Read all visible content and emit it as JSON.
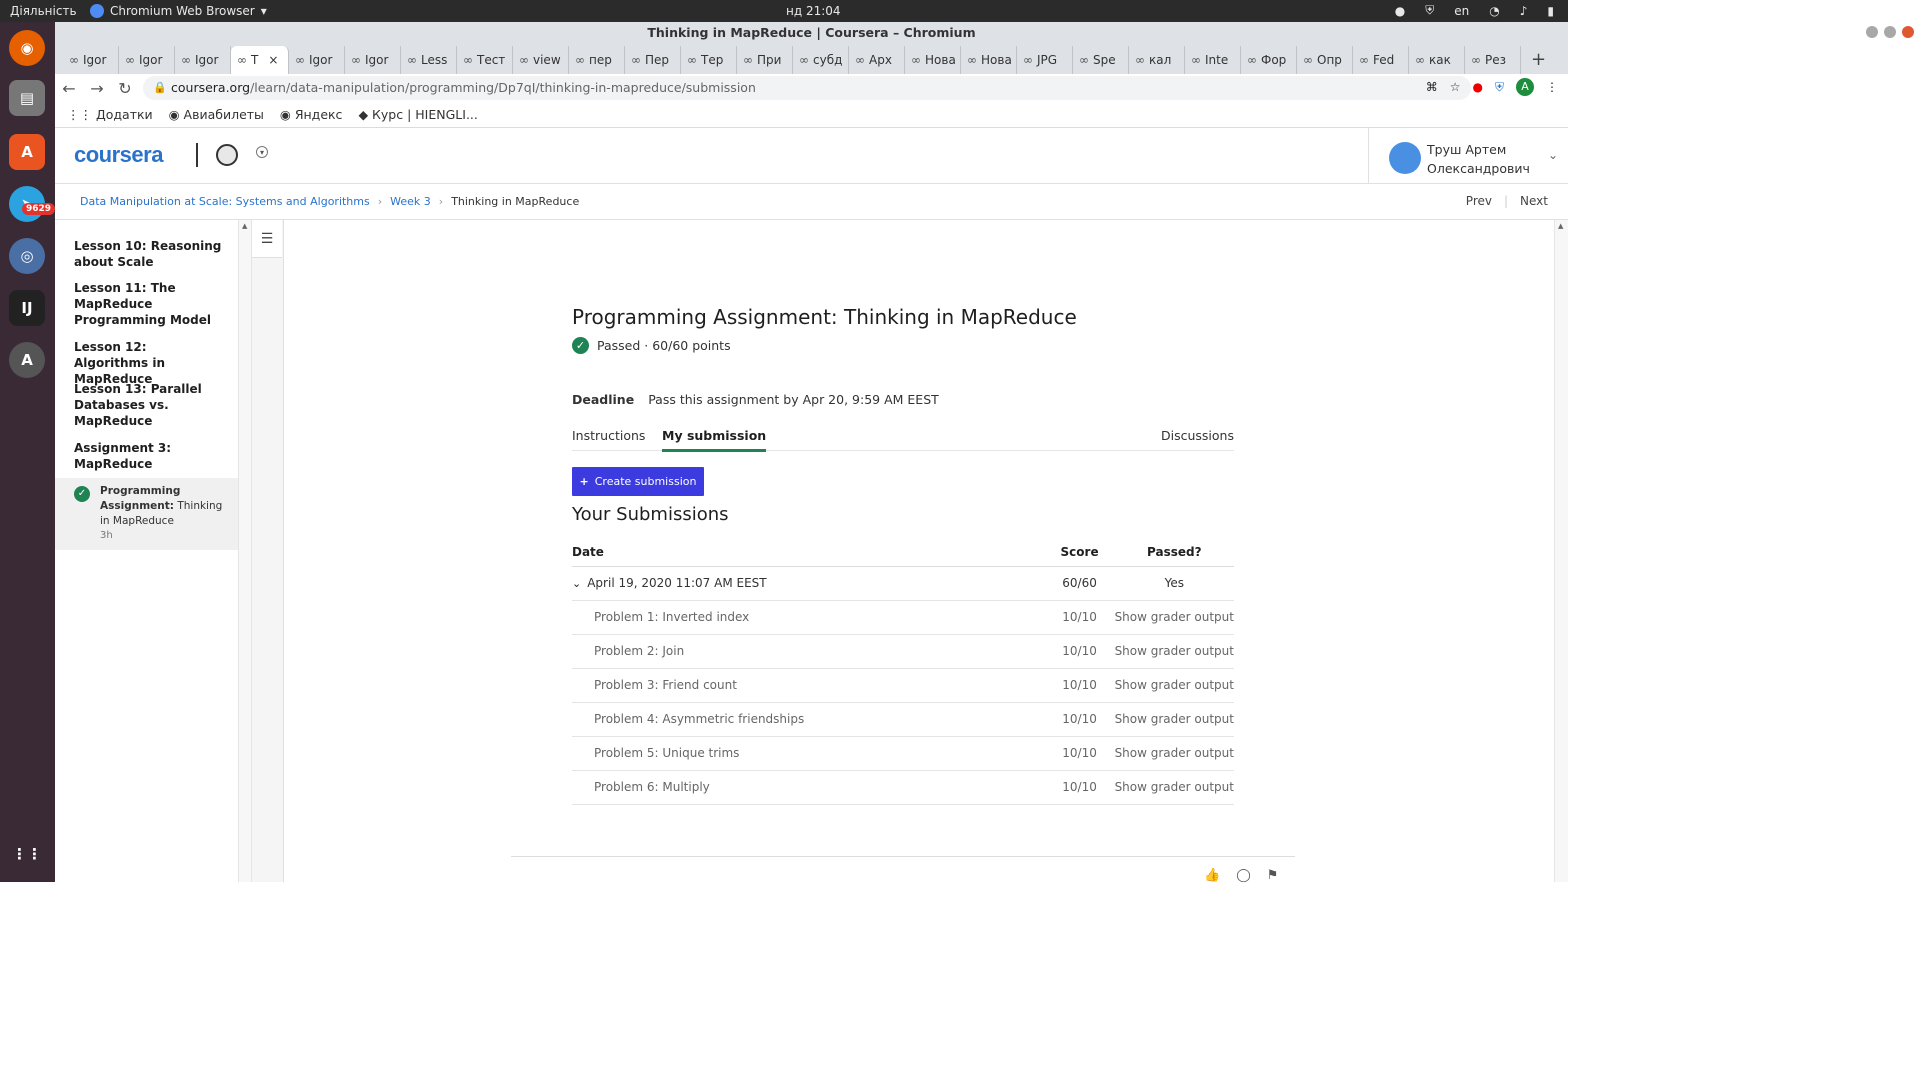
{
  "os": {
    "activities": "Діяльність",
    "app_name": "Chromium Web Browser",
    "clock": "нд 21:04",
    "lang": "en",
    "dock_badge": "9629"
  },
  "browser": {
    "window_title": "Thinking in MapReduce | Coursera – Chromium",
    "tabs": [
      "Igor",
      "Igor",
      "Igor",
      "T",
      "Igor",
      "Igor",
      "Less",
      "Тест",
      "view",
      "пер",
      "Пер",
      "Тер",
      "При",
      "субд",
      "Арх",
      "Нова в",
      "Нова в",
      "JPG",
      "Spe",
      "кал",
      "Inte",
      "Фор",
      "Опр",
      "Fed",
      "как",
      "Рез"
    ],
    "url_host": "coursera.org",
    "url_path": "/learn/data-manipulation/programming/Dp7qI/thinking-in-mapreduce/submission",
    "avatar_letter": "A",
    "bookmarks": [
      "Додатки",
      "Авиабилеты",
      "Яндекс",
      "Курс | HIENGLI..."
    ]
  },
  "header": {
    "logo": "coursera",
    "user_name_1": "Труш Артем",
    "user_name_2": "Олександрович"
  },
  "breadcrumb": {
    "course": "Data Manipulation at Scale: Systems and Algorithms",
    "week": "Week 3",
    "current": "Thinking in MapReduce",
    "prev": "Prev",
    "next": "Next"
  },
  "sidebar": {
    "lessons": [
      "Lesson 10: Reasoning about Scale",
      "Lesson 11: The MapReduce Programming Model",
      "Lesson 12: Algorithms in MapReduce",
      "Lesson 13: Parallel Databases vs. MapReduce",
      "Assignment 3: MapReduce"
    ],
    "current_item_bold": "Programming Assignment:",
    "current_item_rest": "Thinking in MapReduce",
    "current_item_duration": "3h"
  },
  "main": {
    "title": "Programming Assignment: Thinking in MapReduce",
    "passed_text": "Passed · 60/60 points",
    "deadline_label": "Deadline",
    "deadline_text": "Pass this assignment by Apr 20, 9:59 AM EEST",
    "tabs": {
      "instructions": "Instructions",
      "my_submission": "My submission",
      "discussions": "Discussions"
    },
    "create_button": "Create submission",
    "submissions_title": "Your Submissions",
    "columns": {
      "date": "Date",
      "score": "Score",
      "passed": "Passed?"
    },
    "submission": {
      "date": "April 19, 2020 11:07 AM EEST",
      "score": "60/60",
      "passed": "Yes"
    },
    "problems": [
      {
        "name": "Problem 1: Inverted index",
        "score": "10/10",
        "link": "Show grader output"
      },
      {
        "name": "Problem 2: Join",
        "score": "10/10",
        "link": "Show grader output"
      },
      {
        "name": "Problem 3: Friend count",
        "score": "10/10",
        "link": "Show grader output"
      },
      {
        "name": "Problem 4: Asymmetric friendships",
        "score": "10/10",
        "link": "Show grader output"
      },
      {
        "name": "Problem 5: Unique trims",
        "score": "10/10",
        "link": "Show grader output"
      },
      {
        "name": "Problem 6: Multiply",
        "score": "10/10",
        "link": "Show grader output"
      }
    ]
  },
  "colors": {
    "brand": "#2a73cc",
    "success": "#1f8354",
    "button": "#3b3be0"
  }
}
